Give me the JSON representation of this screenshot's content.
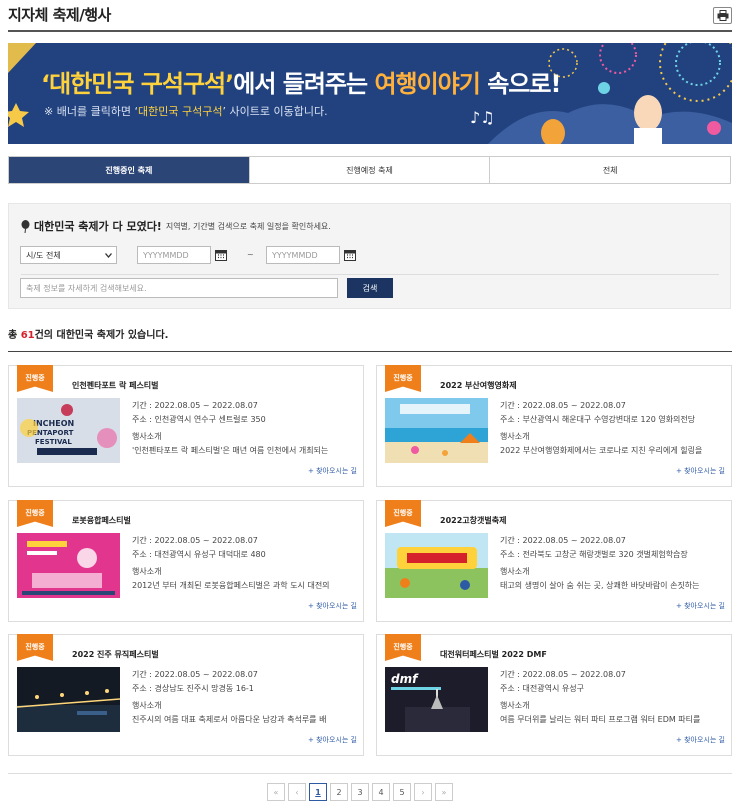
{
  "page": {
    "title": "지자체 축제/행사",
    "print_icon": "printer-icon"
  },
  "banner": {
    "title_part1": "‘대한민국 구석구석’",
    "title_part2": "에서 들려주는 ",
    "title_part3": "여행이야기",
    "title_part4": " 속으로!",
    "sub_part1": "※ 배너를 클릭하면 ‘",
    "sub_part2": "대한민국 구석구석",
    "sub_part3": "’ 사이트로 이동합니다."
  },
  "tabs": [
    {
      "label": "진행중인 축제",
      "active": true
    },
    {
      "label": "진행예정 축제",
      "active": false
    },
    {
      "label": "전체",
      "active": false
    }
  ],
  "search": {
    "title": "대한민국 축제가 다 모였다!",
    "description": "지역별, 기간별 검색으로 축제 일정을 확인하세요.",
    "region_select": "시/도 전체",
    "date_from_placeholder": "YYYYMMDD",
    "date_sep": "~",
    "date_to_placeholder": "YYYYMMDD",
    "keyword_placeholder": "축제 정보를 자세하게 검색해보세요.",
    "button": "검색"
  },
  "total": {
    "prefix": "총 ",
    "count": "61",
    "suffix": "건의 대한민국 축제가 있습니다."
  },
  "festivals": [
    {
      "badge": "진행중",
      "title": "인천펜타포트 락 페스티벌",
      "period": "기간 : 2022.08.05 ~ 2022.08.07",
      "address": "주소 : 인천광역시 연수구 센트럴로 350",
      "intro_label": "행사소개",
      "intro": "'인천펜타포트 락 페스티벌'은 매년 여름 인천에서 개최되는",
      "way": "+ 찾아오시는 길"
    },
    {
      "badge": "진행중",
      "title": "2022 부산여행영화제",
      "period": "기간 : 2022.08.05 ~ 2022.08.07",
      "address": "주소 : 부산광역시 해운대구 수영강변대로 120 영화의전당",
      "intro_label": "행사소개",
      "intro": "2022 부산여행영화제에서는 코로나로 지친 우리에게 힐링을",
      "way": "+ 찾아오시는 길"
    },
    {
      "badge": "진행중",
      "title": "로봇융합페스티벌",
      "period": "기간 : 2022.08.05 ~ 2022.08.07",
      "address": "주소 : 대전광역시 유성구 대덕대로 480",
      "intro_label": "행사소개",
      "intro": "2012년 부터 개최된 로봇융합페스티벌은 과학 도시 대전의",
      "way": "+ 찾아오시는 길"
    },
    {
      "badge": "진행중",
      "title": "2022고창갯벌축제",
      "period": "기간 : 2022.08.05 ~ 2022.08.07",
      "address": "주소 : 전라북도 고창군 해랑갯벌로 320 갯벌체험학습장",
      "intro_label": "행사소개",
      "intro": "태고의 생명이 살아 숨 쉬는 곳, 상쾌한 바닷바람이 손짓하는",
      "way": "+ 찾아오시는 길"
    },
    {
      "badge": "진행중",
      "title": "2022 진주 뮤직페스티벌",
      "period": "기간 : 2022.08.05 ~ 2022.08.07",
      "address": "주소 : 경상남도 진주시 망경동 16-1",
      "intro_label": "행사소개",
      "intro": "진주시의 여름 대표 축제로서 아름다운 남강과 촉석루를 배",
      "way": "+ 찾아오시는 길"
    },
    {
      "badge": "진행중",
      "title": "대전워터페스티벌 2022 DMF",
      "period": "기간 : 2022.08.05 ~ 2022.08.07",
      "address": "주소 : 대전광역시 유성구",
      "intro_label": "행사소개",
      "intro": "여름 무더위를 날리는 워터 파티 프로그램 워터 EDM 파티를",
      "way": "+ 찾아오시는 길"
    }
  ],
  "pagination": {
    "first": "«",
    "prev": "‹",
    "pages": [
      "1",
      "2",
      "3",
      "4",
      "5"
    ],
    "current": "1",
    "next": "›",
    "last": "»"
  },
  "colors": {
    "accent": "#2b4577",
    "badge": "#ef7f1a",
    "count": "#d5212b",
    "link": "#2d5aa5"
  }
}
